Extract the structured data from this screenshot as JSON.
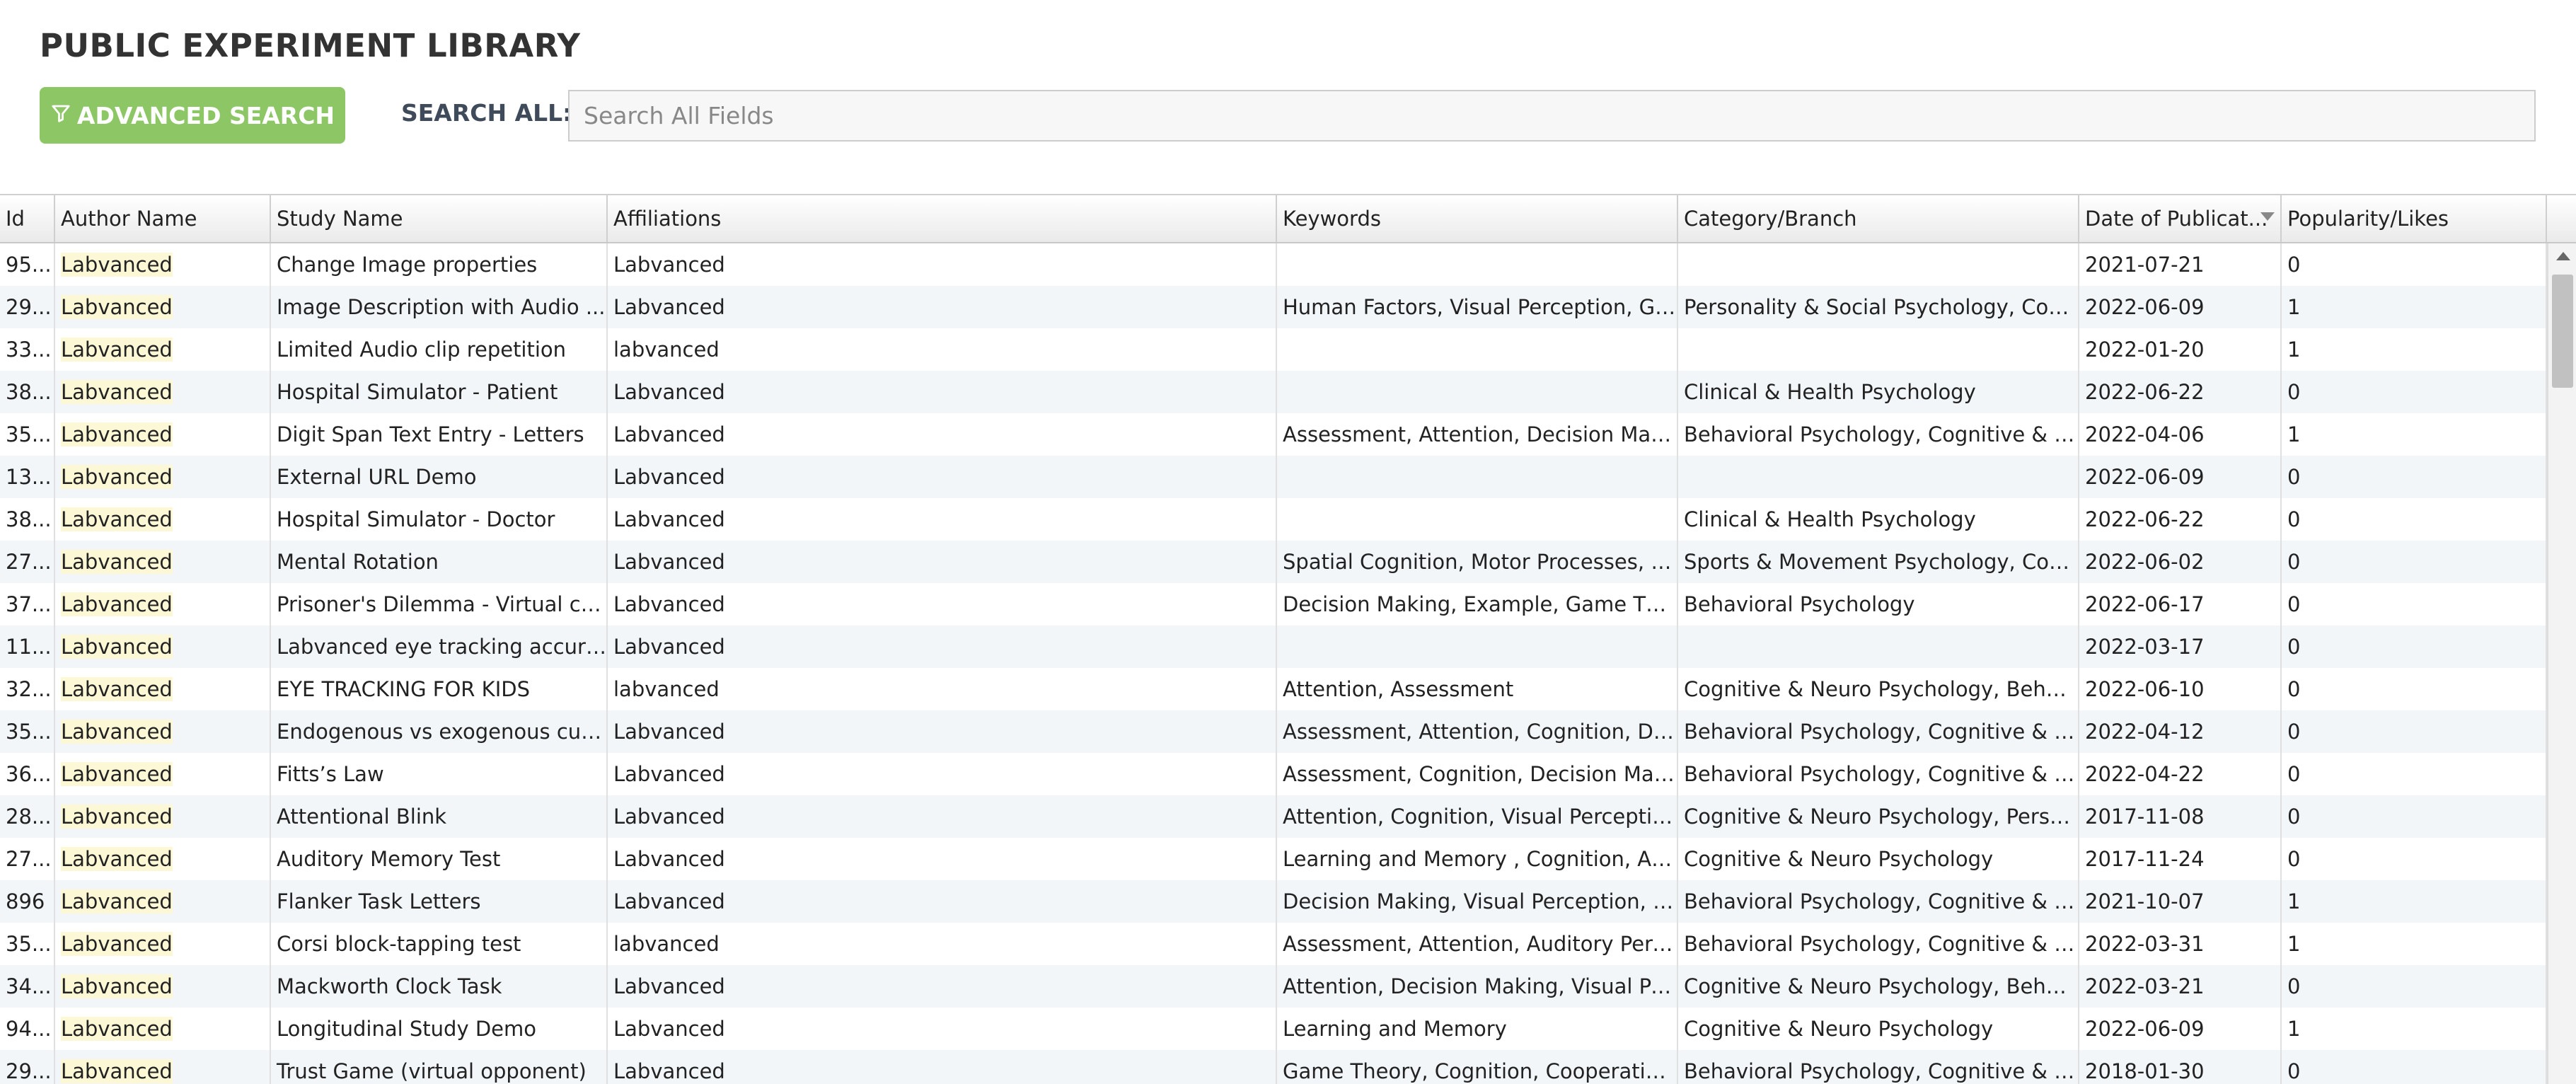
{
  "page": {
    "title": "PUBLIC EXPERIMENT LIBRARY"
  },
  "toolbar": {
    "advanced_search_label": "ADVANCED SEARCH",
    "advanced_search_icon": "filter-icon",
    "search_all_label": "SEARCH ALL:",
    "search_placeholder": "Search All Fields",
    "search_value": ""
  },
  "colors": {
    "button_green": "#8cc665",
    "author_highlight": "#fcf8d6",
    "alt_row": "#f2f6f9"
  },
  "table": {
    "columns": [
      {
        "key": "id",
        "label": "Id"
      },
      {
        "key": "author",
        "label": "Author Name"
      },
      {
        "key": "study",
        "label": "Study Name"
      },
      {
        "key": "affiliations",
        "label": "Affiliations"
      },
      {
        "key": "keywords",
        "label": "Keywords"
      },
      {
        "key": "category",
        "label": "Category/Branch"
      },
      {
        "key": "date",
        "label": "Date of Publicat..."
      },
      {
        "key": "likes",
        "label": "Popularity/Likes"
      }
    ],
    "sorted_column": "date",
    "rows": [
      {
        "id": "95...",
        "author": "Labvanced",
        "study": "Change Image properties",
        "affiliations": "Labvanced",
        "keywords": "",
        "category": "",
        "date": "2021-07-21",
        "likes": "0"
      },
      {
        "id": "29...",
        "author": "Labvanced",
        "study": "Image Description with Audio ...",
        "affiliations": "Labvanced",
        "keywords": "Human Factors, Visual Perception, Ge...",
        "category": "Personality & Social Psychology, Cogn...",
        "date": "2022-06-09",
        "likes": "1"
      },
      {
        "id": "33...",
        "author": "Labvanced",
        "study": "Limited Audio clip repetition",
        "affiliations": "labvanced",
        "keywords": "",
        "category": "",
        "date": "2022-01-20",
        "likes": "1"
      },
      {
        "id": "38...",
        "author": "Labvanced",
        "study": "Hospital Simulator - Patient",
        "affiliations": "Labvanced",
        "keywords": "",
        "category": "Clinical & Health Psychology",
        "date": "2022-06-22",
        "likes": "0"
      },
      {
        "id": "35...",
        "author": "Labvanced",
        "study": "Digit Span Text Entry - Letters",
        "affiliations": "Labvanced",
        "keywords": "Assessment, Attention, Decision Maki...",
        "category": "Behavioral Psychology, Cognitive & N...",
        "date": "2022-04-06",
        "likes": "1"
      },
      {
        "id": "13...",
        "author": "Labvanced",
        "study": "External URL Demo",
        "affiliations": "Labvanced",
        "keywords": "",
        "category": "",
        "date": "2022-06-09",
        "likes": "0"
      },
      {
        "id": "38...",
        "author": "Labvanced",
        "study": "Hospital Simulator - Doctor",
        "affiliations": "Labvanced",
        "keywords": "",
        "category": "Clinical & Health Psychology",
        "date": "2022-06-22",
        "likes": "0"
      },
      {
        "id": "27...",
        "author": "Labvanced",
        "study": "Mental Rotation",
        "affiliations": "Labvanced",
        "keywords": "Spatial Cognition, Motor Processes, Vi...",
        "category": "Sports & Movement Psychology, Cogn...",
        "date": "2022-06-02",
        "likes": "0"
      },
      {
        "id": "37...",
        "author": "Labvanced",
        "study": "Prisoner's Dilemma - Virtual co...",
        "affiliations": "Labvanced",
        "keywords": "Decision Making, Example, Game The...",
        "category": "Behavioral Psychology",
        "date": "2022-06-17",
        "likes": "0"
      },
      {
        "id": "11...",
        "author": "Labvanced",
        "study": "Labvanced eye tracking accura...",
        "affiliations": "Labvanced",
        "keywords": "",
        "category": "",
        "date": "2022-03-17",
        "likes": "0"
      },
      {
        "id": "32...",
        "author": "Labvanced",
        "study": "EYE TRACKING FOR KIDS",
        "affiliations": "labvanced",
        "keywords": "Attention, Assessment",
        "category": "Cognitive & Neuro Psychology, Behavi...",
        "date": "2022-06-10",
        "likes": "0"
      },
      {
        "id": "35...",
        "author": "Labvanced",
        "study": "Endogenous vs exogenous cuei...",
        "affiliations": "Labvanced",
        "keywords": "Assessment, Attention, Cognition, De...",
        "category": "Behavioral Psychology, Cognitive & N...",
        "date": "2022-04-12",
        "likes": "0"
      },
      {
        "id": "36...",
        "author": "Labvanced",
        "study": "Fitts’s Law",
        "affiliations": "Labvanced",
        "keywords": "Assessment, Cognition, Decision Maki...",
        "category": "Behavioral Psychology, Cognitive & N...",
        "date": "2022-04-22",
        "likes": "0"
      },
      {
        "id": "28...",
        "author": "Labvanced",
        "study": "Attentional Blink",
        "affiliations": "Labvanced",
        "keywords": "Attention, Cognition, Visual Perceptio...",
        "category": "Cognitive & Neuro Psychology, Person...",
        "date": "2017-11-08",
        "likes": "0"
      },
      {
        "id": "27...",
        "author": "Labvanced",
        "study": "Auditory Memory Test",
        "affiliations": "Labvanced",
        "keywords": "Learning and Memory , Cognition, Au...",
        "category": "Cognitive & Neuro Psychology",
        "date": "2017-11-24",
        "likes": "0"
      },
      {
        "id": "896",
        "author": "Labvanced",
        "study": "Flanker Task Letters",
        "affiliations": "Labvanced",
        "keywords": "Decision Making, Visual Perception, Bi...",
        "category": "Behavioral Psychology, Cognitive & N...",
        "date": "2021-10-07",
        "likes": "1"
      },
      {
        "id": "35...",
        "author": "Labvanced",
        "study": "Corsi block-tapping test",
        "affiliations": "labvanced",
        "keywords": "Assessment, Attention, Auditory Perc...",
        "category": "Behavioral Psychology, Cognitive & N...",
        "date": "2022-03-31",
        "likes": "1"
      },
      {
        "id": "34...",
        "author": "Labvanced",
        "study": "Mackworth Clock Task",
        "affiliations": "Labvanced",
        "keywords": "Attention, Decision Making, Visual Per...",
        "category": "Cognitive & Neuro Psychology, Behavi...",
        "date": "2022-03-21",
        "likes": "0"
      },
      {
        "id": "94...",
        "author": "Labvanced",
        "study": "Longitudinal Study Demo",
        "affiliations": "Labvanced",
        "keywords": "Learning and Memory",
        "category": "Cognitive & Neuro Psychology",
        "date": "2022-06-09",
        "likes": "1"
      },
      {
        "id": "29...",
        "author": "Labvanced",
        "study": "Trust Game (virtual opponent)",
        "affiliations": "Labvanced",
        "keywords": "Game Theory, Cognition, Cooperative...",
        "category": "Behavioral Psychology, Cognitive & N...",
        "date": "2018-01-30",
        "likes": "0"
      }
    ]
  }
}
